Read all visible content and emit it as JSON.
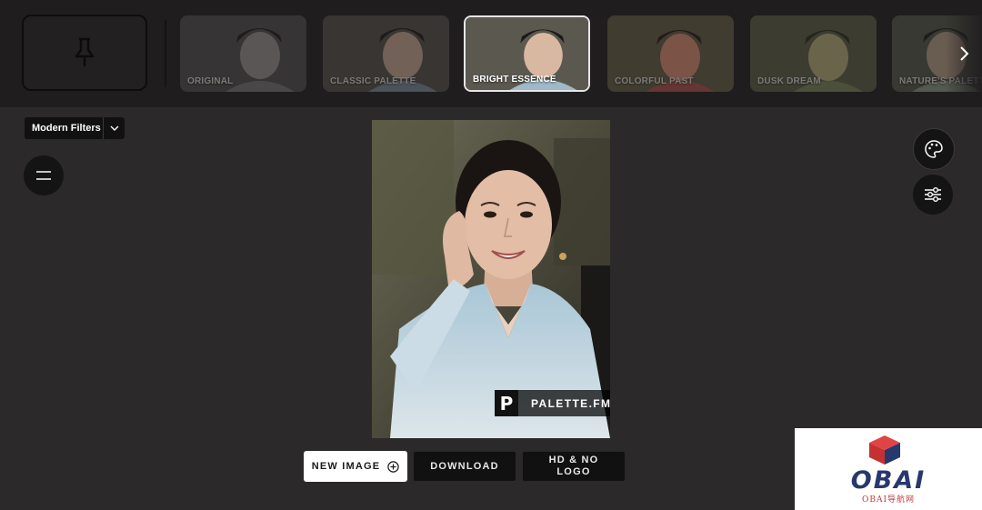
{
  "filters": {
    "items": [
      {
        "label": "ORIGINAL",
        "active": false
      },
      {
        "label": "CLASSIC PALETTE",
        "active": false
      },
      {
        "label": "BRIGHT ESSENCE",
        "active": true
      },
      {
        "label": "COLORFUL PAST",
        "active": false
      },
      {
        "label": "DUSK DREAM",
        "active": false
      },
      {
        "label": "NATURE'S PALETTE",
        "active": false
      }
    ],
    "pin_icon": "pin-icon",
    "next_icon": "chevron-right-icon"
  },
  "category_select": {
    "value": "Modern Filters",
    "icon": "chevron-down-icon"
  },
  "left_tools": {
    "menu_icon": "hamburger-menu-icon"
  },
  "right_tools": {
    "palette_icon": "palette-icon",
    "adjust_icon": "sliders-icon"
  },
  "watermark": {
    "letter": "P",
    "text": "PALETTE.FM"
  },
  "actions": {
    "new_image": "NEW IMAGE",
    "new_image_icon": "plus-circle-icon",
    "download": "DOWNLOAD",
    "hd_no_logo": "HD & NO LOGO"
  },
  "site_logo": {
    "brand": "OBAI",
    "sub": "OBAI导航网"
  },
  "colors": {
    "background": "#2b292a",
    "toolbar": "#1f1d1e",
    "button_dark": "#121111",
    "button_light": "#ffffff",
    "logo_blue": "#27386f",
    "logo_red": "#d63a3a"
  }
}
